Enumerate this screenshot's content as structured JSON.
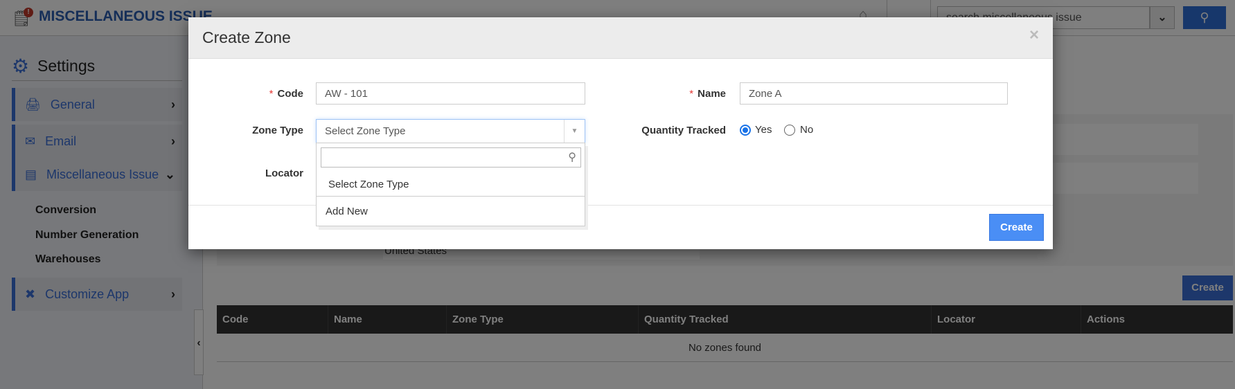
{
  "header": {
    "title": "MISCELLANEOUS ISSUE",
    "notification_badge": "!",
    "search_placeholder": "search miscellaneous issue"
  },
  "sidebar": {
    "heading": "Settings",
    "items": [
      {
        "label": "General",
        "icon": "monitor-icon"
      },
      {
        "label": "Email",
        "icon": "envelope-icon"
      },
      {
        "label": "Miscellaneous Issue",
        "icon": "form-icon",
        "expanded": true
      },
      {
        "label": "Customize App",
        "icon": "tools-icon"
      }
    ],
    "subitems": [
      "Conversion",
      "Number Generation",
      "Warehouses"
    ]
  },
  "main": {
    "country": "United States",
    "create_label": "Create",
    "table": {
      "columns": [
        "Code",
        "Name",
        "Zone Type",
        "Quantity Tracked",
        "Locator",
        "Actions"
      ],
      "empty_text": "No zones found"
    }
  },
  "modal": {
    "title": "Create Zone",
    "close": "×",
    "code_label": "Code",
    "code_value": "AW - 101",
    "name_label": "Name",
    "name_value": "Zone A",
    "zone_type_label": "Zone Type",
    "zone_type_value": "Select Zone Type",
    "quantity_tracked_label": "Quantity Tracked",
    "yes_label": "Yes",
    "no_label": "No",
    "quantity_tracked": "Yes",
    "locator_label": "Locator",
    "dropdown_options": [
      "Select Zone Type",
      "Add New"
    ],
    "create_label": "Create"
  },
  "colors": {
    "accent": "#3b6fd6",
    "primary_button": "#4a8ef5",
    "table_header": "#333333"
  }
}
